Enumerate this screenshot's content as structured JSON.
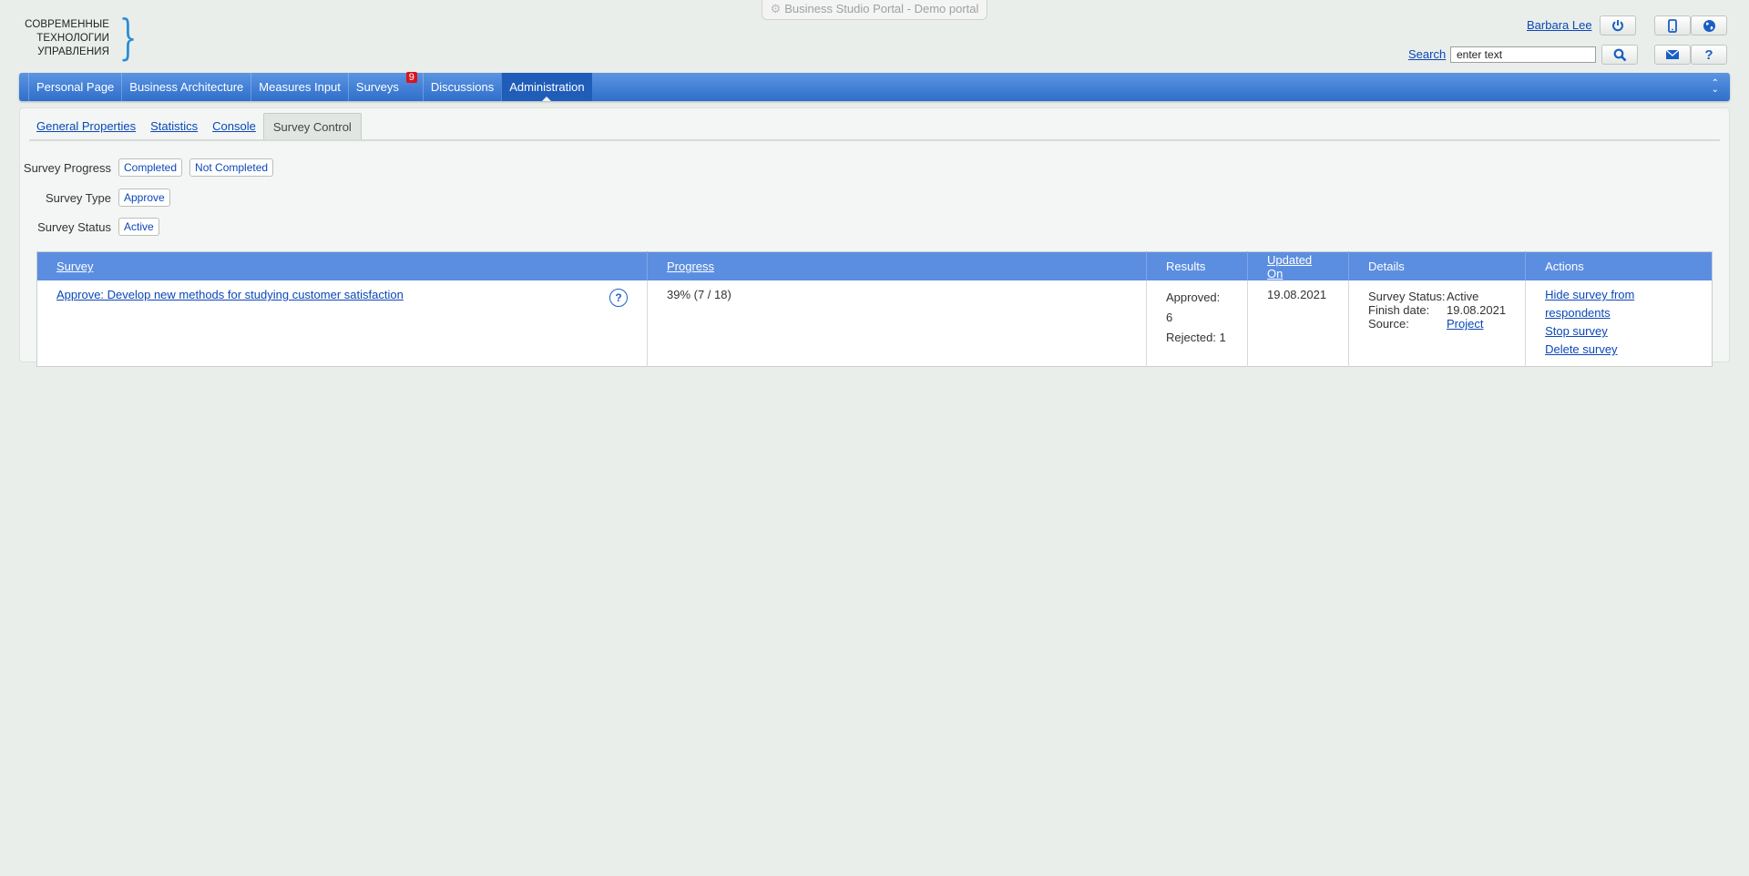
{
  "window": {
    "title": "Business Studio Portal - Demo portal"
  },
  "logo": {
    "lines": [
      "СОВРЕМЕННЫЕ",
      "ТЕХНОЛОГИИ",
      "УПРАВЛЕНИЯ"
    ]
  },
  "user": {
    "name": "Barbara Lee"
  },
  "search": {
    "label": "Search",
    "value": "enter text"
  },
  "nav": {
    "items": [
      {
        "label": "Personal Page"
      },
      {
        "label": "Business Architecture"
      },
      {
        "label": "Measures Input"
      },
      {
        "label": "Surveys",
        "badge": "9"
      },
      {
        "label": "Discussions"
      },
      {
        "label": "Administration",
        "active": true
      }
    ]
  },
  "subtabs": [
    "General Properties",
    "Statistics",
    "Console",
    "Survey Control"
  ],
  "filters": {
    "progress": {
      "label": "Survey Progress",
      "options": [
        "Completed",
        "Not Completed"
      ]
    },
    "type": {
      "label": "Survey Type",
      "options": [
        "Approve"
      ]
    },
    "status": {
      "label": "Survey Status",
      "options": [
        "Active"
      ]
    }
  },
  "table": {
    "headers": [
      "Survey",
      "Progress",
      "Results",
      "Updated On",
      "Details",
      "Actions"
    ],
    "rows": [
      {
        "survey": "Approve: Develop new methods for studying customer satisfaction",
        "progress": "39% (7 / 18)",
        "results": [
          "Approved: 6",
          "Rejected: 1"
        ],
        "updated_on": "19.08.2021",
        "details": {
          "status_key": "Survey Status:",
          "status_val": "Active",
          "finish_key": "Finish date:",
          "finish_val": "19.08.2021",
          "source_key": "Source:",
          "source_val": "Project"
        },
        "actions": [
          "Hide survey from respondents",
          "Stop survey",
          "Delete survey"
        ]
      }
    ]
  },
  "icons": {
    "power": "power-icon",
    "mobile": "mobile-icon",
    "globe": "globe-icon",
    "search": "search-icon",
    "mail": "mail-icon",
    "help": "help-icon"
  },
  "colors": {
    "nav": "#2f6fcb",
    "header": "#5b8ee0",
    "link": "#0b47b8",
    "badge": "#d9141b"
  }
}
